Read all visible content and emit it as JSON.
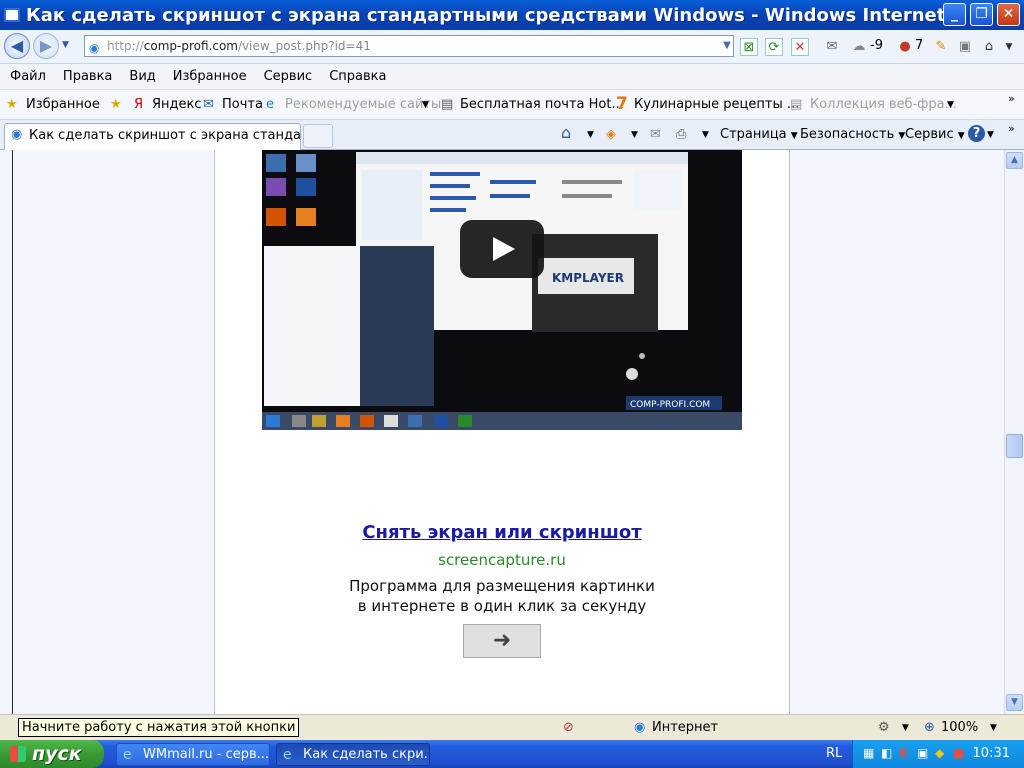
{
  "window": {
    "title": "Как сделать скриншот с экрана стандартными средствами Windows - Windows Internet Explorer ..."
  },
  "address_bar": {
    "prefix": "http://",
    "host": "comp-profi.com",
    "path": "/view_post.php?id=41"
  },
  "weather": {
    "temp": "-9",
    "count": "7"
  },
  "menu": [
    "Файл",
    "Правка",
    "Вид",
    "Избранное",
    "Сервис",
    "Справка"
  ],
  "favorites_bar": {
    "favorites_label": "Избранное",
    "items": [
      {
        "label": "Яндекс",
        "dim": false
      },
      {
        "label": "Почта",
        "dim": false
      },
      {
        "label": "Рекомендуемые сайты",
        "dim": true
      },
      {
        "label": "Бесплатная почта Hot...",
        "dim": false
      },
      {
        "label": "Кулинарные рецепты ...",
        "dim": false
      },
      {
        "label": "Коллекция веб-фра...",
        "dim": true
      }
    ]
  },
  "tab": {
    "title": "Как сделать скриншот с экрана стандартн..."
  },
  "command_bar": {
    "page": "Страница",
    "security": "Безопасность",
    "tools": "Сервис"
  },
  "ad": {
    "link": "Снять экран или скриншот",
    "url": "screencapture.ru",
    "line1": "Программа для размещения картинки",
    "line2": "в интернете в один клик за секунду",
    "button_icon": "arrow-right-icon"
  },
  "video_embed": {
    "player_name": "KMPLAYER",
    "watermark": "COMP-PROFI.COM"
  },
  "status_bar": {
    "tooltip": "Начните работу с нажатия этой кнопки",
    "zone": "Интернет",
    "zoom": "100%"
  },
  "taskbar": {
    "start_label": "пуск",
    "tasks": [
      "WMmail.ru - серв...",
      "Как сделать скри..."
    ],
    "lang": "RL",
    "clock": "10:31"
  }
}
